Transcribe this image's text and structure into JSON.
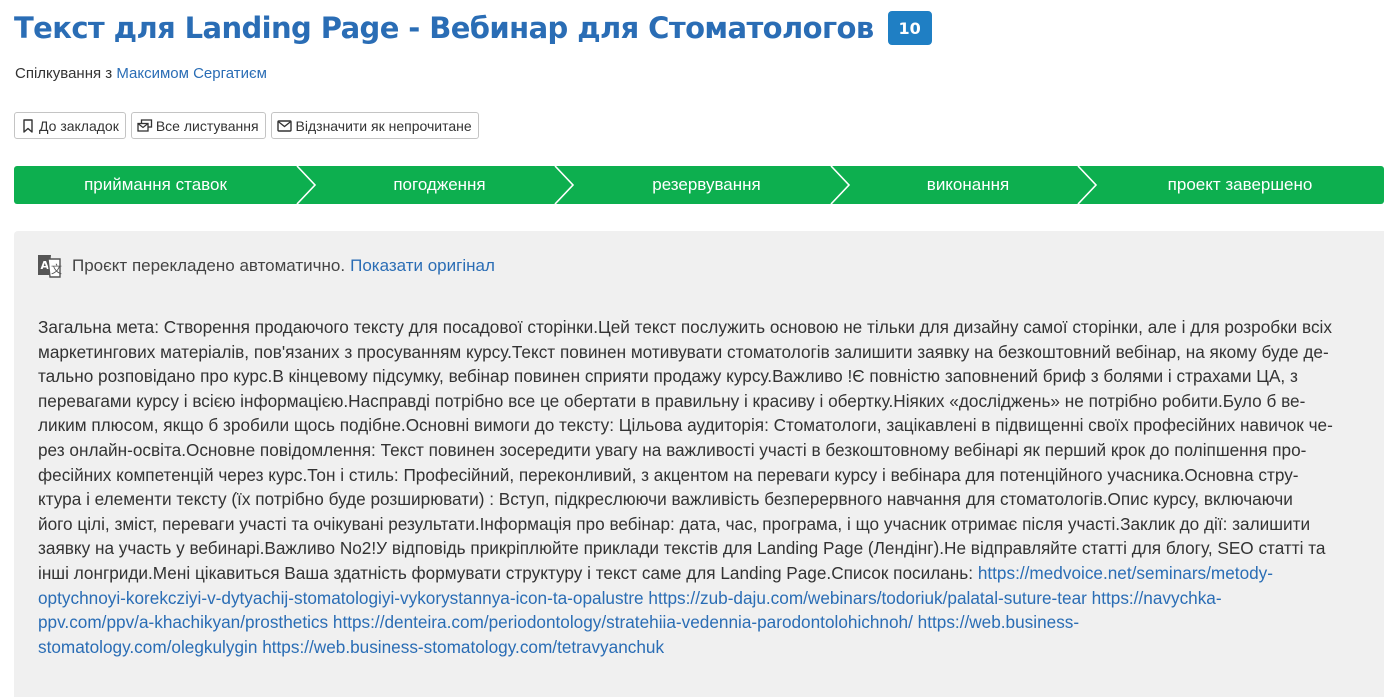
{
  "header": {
    "title": "Текст для Landing Page - Вебинар для Стоматологов",
    "count_badge": "10",
    "subtitle_prefix": "Спілкування з",
    "subtitle_person": "Максимом Сергатиєм"
  },
  "actions": {
    "bookmark_label": "До закладок",
    "all_messages_label": "Все листування",
    "mark_unread_label": "Відзначити як непрочитане"
  },
  "stages": [
    {
      "label": "приймання ставок"
    },
    {
      "label": "погодження"
    },
    {
      "label": "резервування"
    },
    {
      "label": "виконання"
    },
    {
      "label": "проект завершено"
    }
  ],
  "translation": {
    "notice": "Проєкт перекладено автоматично.",
    "show_original_link": "Показати оригінал"
  },
  "description": {
    "lines": [
      "Загальна мета: Створення продаючого тексту для посадової сторінки.Цей текст послужить основою не тільки для дизайну самої сторінки, але і для розробки всіх",
      "маркетингових матеріалів, пов'язаних з просуванням курсу.Текст повинен мотивувати стоматологів залишити заявку на безкоштовний вебінар, на якому буде де-",
      "тально розповідано про курс.В кінцевому підсумку, вебінар повинен сприяти продажу курсу.Важливо !Є повністю заповнений бриф з болями і страхами ЦА, з",
      "перевагами курсу і всією інформацією.Насправді потрібно все це обертати в правильну і красиву і обертку.Ніяких «досліджень» не потрібно робити.Було б ве-",
      "ликим плюсом, якщо б зробили щось подібне.Основні вимоги до тексту: Цільова аудиторія: Стоматологи, зацікавлені в підвищенні своїх професійних навичок че-",
      "рез онлайн-освіта.Основне повідомлення: Текст повинен зосередити увагу на важливості участі в безкоштовному вебінарі як перший крок до поліпшення про-",
      "фесійних компетенцій через курс.Тон і стиль: Професійний, переконливий, з акцентом на переваги курсу і вебінара для потенційного учасника.Основна стру-",
      "ктура і елементи тексту (їх потрібно буде розширювати) : Вступ, підкреслюючи важливість безперервного навчання для стоматологів.Опис курсу, включаючи",
      "його цілі, зміст, переваги участі та очікувані результати.Інформація про вебінар: дата, час, програма, і що учасник отримає після участі.Заклик до дії: залишити",
      "заявку на участь у вебинарі.Важливо No2!У відповідь прикріплюйте приклади текстів для Landing Page (Лендінг).Не відправляйте статті для блогу, SEO статті та",
      "інші лонгриди.Мені цікавиться Ваша здатність формувати структуру і текст саме для Landing Page.Список посилань:"
    ],
    "links": [
      "https://medvoice.net/seminars/metody-",
      "optychnoyi-korekcziyi-v-dytyachij-stomatologiyi-vykorystannya-icon-ta-opalustre",
      "https://zub-daju.com/webinars/todoriuk/palatal-suture-tear",
      "https://navychka-",
      "ppv.com/ppv/a-khachikyan/prosthetics",
      "https://denteira.com/periodontology/stratehiia-vedennia-parodontolohichnoh/",
      "https://web.business-",
      "stomatology.com/olegkulygin",
      "https://web.business-stomatology.com/tetravyanchuk"
    ]
  },
  "colors": {
    "accent_blue": "#2a6db5",
    "badge_blue": "#1f7fc4",
    "stage_green": "#0daf4f",
    "panel_gray": "#f0f0f0"
  },
  "icons": {
    "bookmark": "bookmark-icon",
    "messages": "messages-icon",
    "envelope": "envelope-icon",
    "translate": "translate-icon"
  }
}
